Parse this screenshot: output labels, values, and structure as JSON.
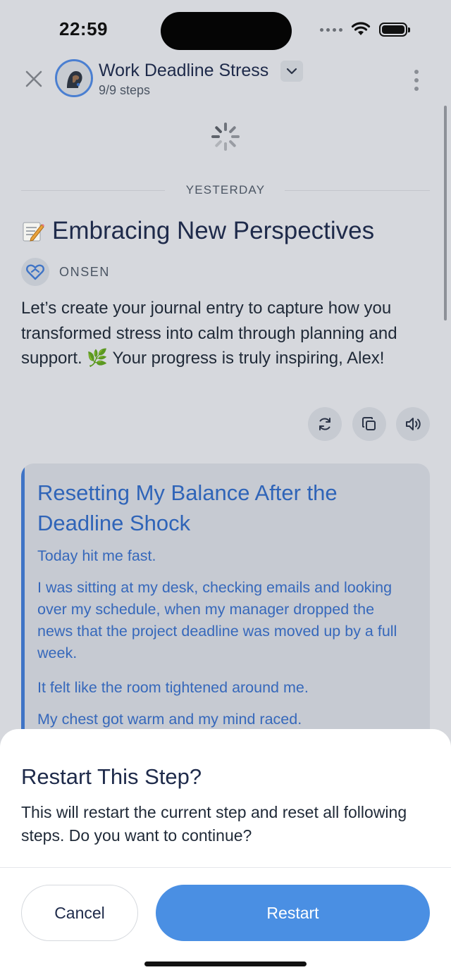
{
  "status_bar": {
    "time": "22:59"
  },
  "header": {
    "title": "Work Deadline Stress",
    "steps": "9/9 steps"
  },
  "feed": {
    "date_divider": "YESTERDAY",
    "heading": "Embracing New Perspectives",
    "heading_emoji": "📝",
    "brand": "ONSEN",
    "message": "Let’s create your journal entry to capture how you transformed stress into calm through planning and support. 🌿 Your progress is truly inspiring, Alex!",
    "actions": [
      "regenerate-icon",
      "copy-icon",
      "speaker-icon"
    ]
  },
  "journal": {
    "title": "Resetting My Balance After the Deadline Shock",
    "paragraphs": [
      "Today hit me fast.",
      "I was sitting at my desk, checking emails and looking over my schedule, when my manager dropped the news that the project deadline was moved up by a full week.",
      "It felt like the room tightened around me.",
      "My chest got warm and my mind raced."
    ]
  },
  "sheet": {
    "title": "Restart This Step?",
    "message": "This will restart the current step and reset all following steps. Do you want to continue?",
    "cancel_label": "Cancel",
    "restart_label": "Restart"
  },
  "colors": {
    "accent": "#4a8fe3",
    "journal_text": "#3668bb",
    "overlay_bg": "#d6d8dd"
  }
}
